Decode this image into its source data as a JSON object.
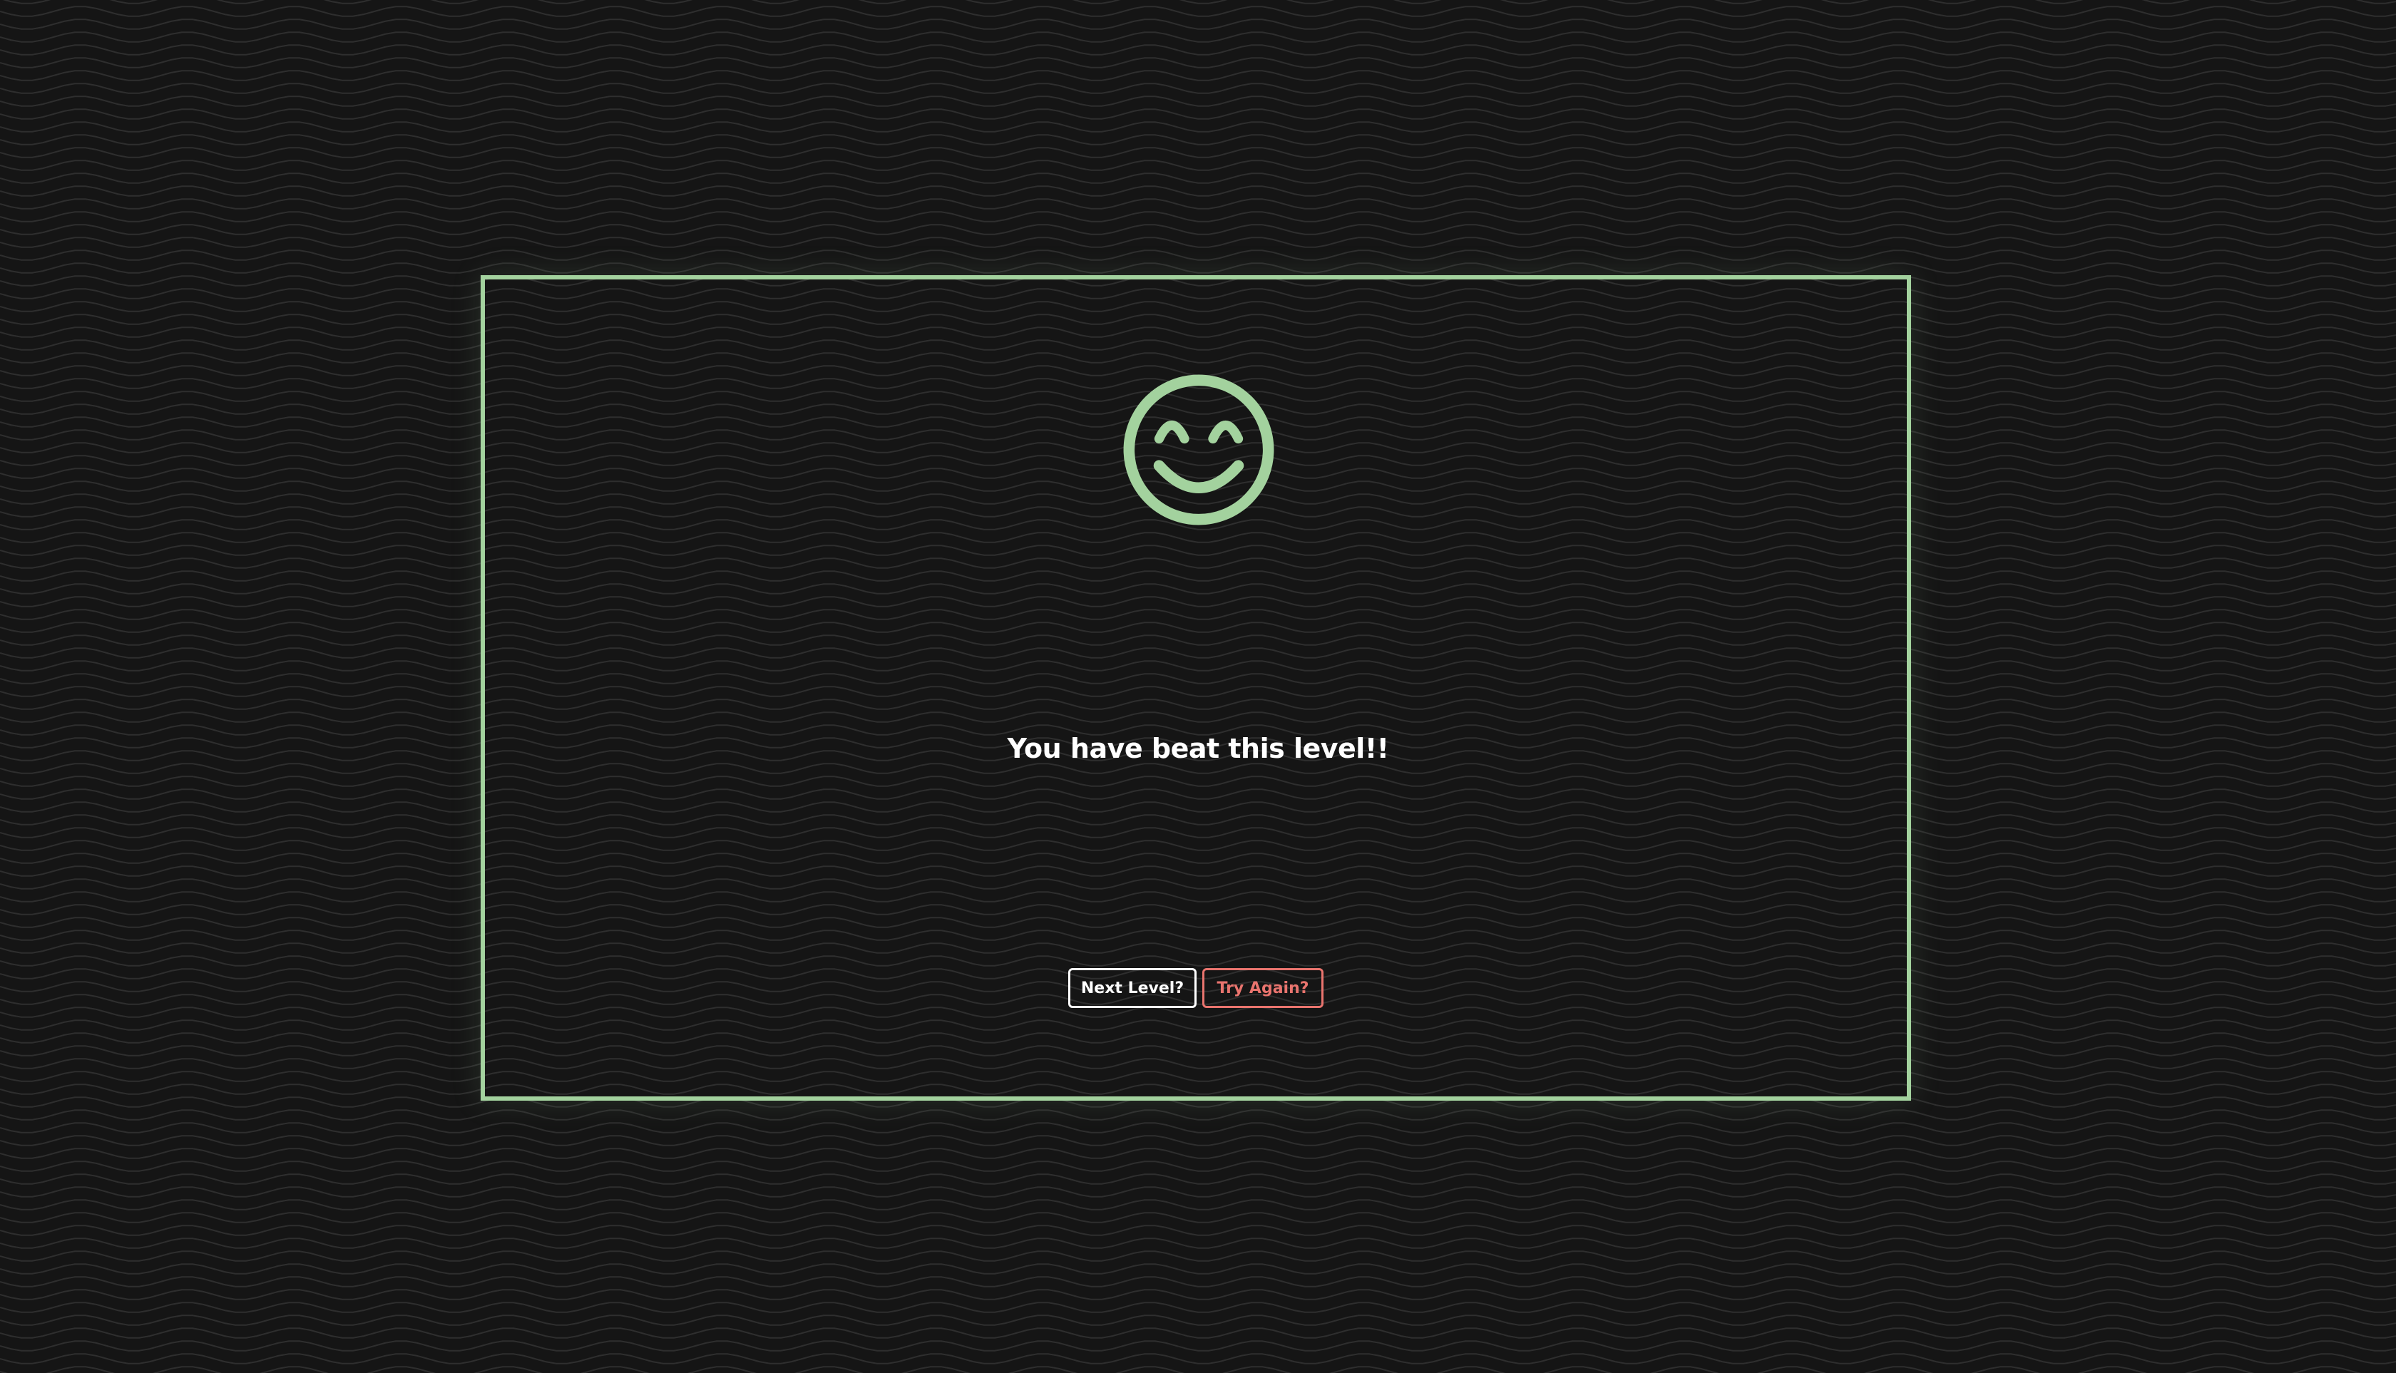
{
  "dialog": {
    "message": "You have beat this level!!",
    "icon": "smiling-face-icon"
  },
  "buttons": {
    "next_label": "Next Level?",
    "retry_label": "Try Again?"
  },
  "colors": {
    "background": "#151515",
    "wave_lines": "#2e2e2e",
    "accent_green": "#a3d29e",
    "retry_red": "#e9746e",
    "text": "#ffffff"
  }
}
